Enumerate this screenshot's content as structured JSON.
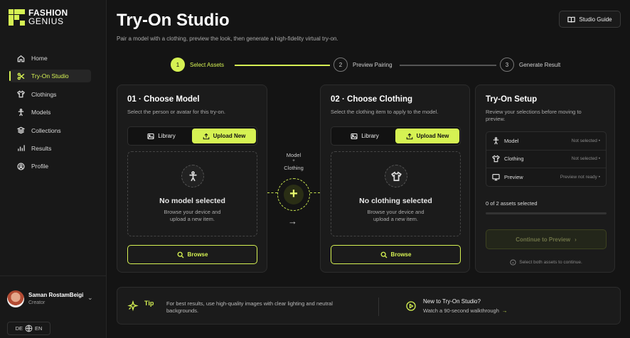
{
  "brand": {
    "line1": "FASHION",
    "line2": "GENIUS"
  },
  "nav": [
    {
      "label": "Home",
      "icon": "home-icon"
    },
    {
      "label": "Try-On Studio",
      "icon": "scissors-icon",
      "active": true
    },
    {
      "label": "Clothings",
      "icon": "shirt-icon"
    },
    {
      "label": "Models",
      "icon": "person-icon"
    },
    {
      "label": "Collections",
      "icon": "layers-icon"
    },
    {
      "label": "Results",
      "icon": "chart-icon"
    },
    {
      "label": "Profile",
      "icon": "profile-icon"
    }
  ],
  "user": {
    "name": "Saman RostamBeigi",
    "role": "Creator"
  },
  "lang": {
    "left": "DE",
    "right": "EN"
  },
  "page": {
    "title": "Try-On Studio",
    "subtitle": "Pair a model with a clothing, preview the look, then generate a high-fidelity virtual try-on.",
    "guide_label": "Studio Guide"
  },
  "steps": [
    {
      "num": "1",
      "label": "Select Assets"
    },
    {
      "num": "2",
      "label": "Preview Pairing"
    },
    {
      "num": "3",
      "label": "Generate Result"
    }
  ],
  "model_card": {
    "title": "01 · Choose Model",
    "subtitle": "Select the person or avatar for this try-on.",
    "library": "Library",
    "upload": "Upload New",
    "empty_title": "No model selected",
    "empty_text": "Browse your device and upload a new item.",
    "browse": "Browse"
  },
  "clothing_card": {
    "title": "02 · Choose Clothing",
    "subtitle": "Select the clothing item to apply to the model.",
    "library": "Library",
    "upload": "Upload New",
    "empty_title": "No clothing selected",
    "empty_text": "Browse your device and upload a new item.",
    "browse": "Browse"
  },
  "connector": {
    "line1": "Model",
    "line2": "+",
    "line3": "Clothing"
  },
  "setup": {
    "title": "Try-On Setup",
    "subtitle": "Review your selections before moving to preview.",
    "rows": [
      {
        "label": "Model",
        "value": "Not selected •",
        "icon": "person-icon"
      },
      {
        "label": "Clothing",
        "value": "Not selected •",
        "icon": "shirt-icon"
      },
      {
        "label": "Preview",
        "value": "Preview not ready •",
        "icon": "monitor-icon"
      }
    ],
    "count": "0 of 2 assets selected",
    "progress": 0,
    "continue": "Continue to Preview",
    "hint": "Select both assets to continue."
  },
  "tip": {
    "label": "Tip",
    "text": "For best results, use high-quality images with clear lighting and neutral backgrounds.",
    "new_title": "New to Try-On Studio?",
    "new_sub": "Watch a 90-second walkthrough"
  },
  "colors": {
    "accent": "#d6f253",
    "bg": "#141414",
    "card": "#1b1b1b"
  }
}
